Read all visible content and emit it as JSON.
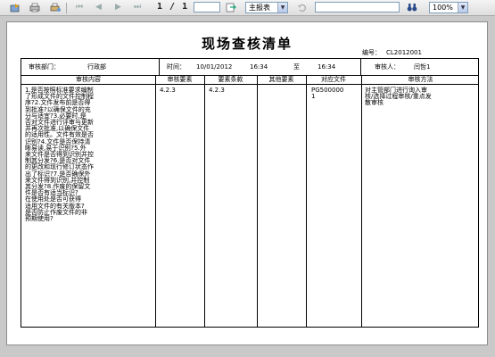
{
  "toolbar": {
    "page_indicator": "1 / 1",
    "goto_value": "",
    "view_select": "主报表",
    "search_value": "",
    "zoom": "100%",
    "icons": [
      "export-icon",
      "print-icon",
      "print-setup-icon",
      "first-page-icon",
      "prev-page-icon",
      "next-page-icon",
      "last-page-icon",
      "goto-icon",
      "refresh-icon",
      "binoculars-icon"
    ]
  },
  "report": {
    "title": "现场查核清单",
    "docno_label": "编号：",
    "docno": "CL2012001",
    "info": {
      "dept_label": "审核部门：",
      "dept": "行政部",
      "time_label": "时间：",
      "date": "10/01/2012",
      "start": "16:34",
      "to": "至",
      "end": "16:34",
      "auditor_label": "审核人：",
      "auditor": "闫哲1"
    },
    "columns": [
      "审核内容",
      "审核要素",
      "要素条款",
      "其他要素",
      "对应文件",
      "审核方法"
    ],
    "rows": [
      {
        "content": "1.是否按照标准要求编制\n了形成文件的文件控制程\n序?2.文件发布前是否得\n到批准?以确保文件的充\n分与适宜?3.必要时,是\n否对文件进行评审与更新\n并再次批准,以确保文件\n的适用性。文件有效是否\n识别?4.文件是否保持清\n晰易读,易于识别?5.外\n来文件是否得到识别并控\n制其分发?6.是否对文件\n的更改和现行修订状态作\n出了标识?7.是否确保外\n来文件得到识别,并控制\n其分发?8.作废的保留文\n件是否有适当标识?\n在使用处是否可获得\n适用文件的有关版本?\n是否防止作废文件的非\n预期使用?",
        "element": "4.2.3",
        "clause": "4.2.3",
        "other": "",
        "file": "PG500000\n1",
        "method": "对主管部门进行询入审\n核/选择过程审核/重点发\n散审核"
      }
    ]
  }
}
